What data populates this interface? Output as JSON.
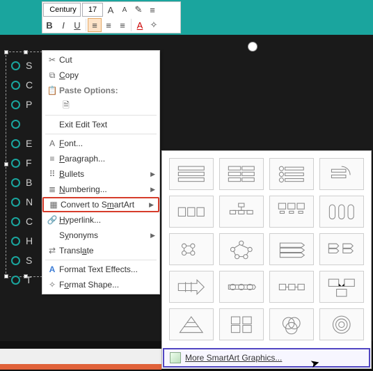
{
  "toolbar": {
    "font_name": "Century",
    "font_size": "17",
    "grow_font": "A",
    "shrink_font": "A",
    "bold": "B",
    "italic": "I",
    "underline": "U"
  },
  "bullets": [
    "S",
    "C",
    "P",
    "",
    "E",
    "F",
    "B",
    "N",
    "C",
    "H",
    "S",
    "T"
  ],
  "ctx": {
    "cut": "Cut",
    "copy": "Copy",
    "paste_hdr": "Paste Options:",
    "exit_edit": "Exit Edit Text",
    "font": "Font...",
    "paragraph": "Paragraph...",
    "bullets": "Bullets",
    "numbering": "Numbering...",
    "convert": "Convert to SmartArt",
    "hyperlink": "Hyperlink...",
    "synonyms": "Synonyms",
    "translate": "Translate",
    "fmt_text": "Format Text Effects...",
    "fmt_shape": "Format Shape..."
  },
  "gallery": {
    "more": "More SmartArt Graphics..."
  }
}
